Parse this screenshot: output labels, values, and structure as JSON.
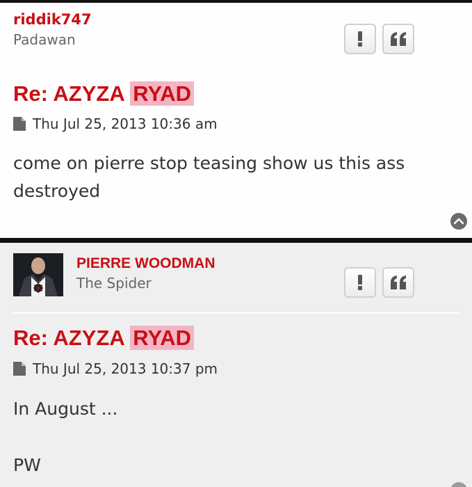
{
  "posts": [
    {
      "username": "riddik747",
      "rank": "Padawan",
      "title_prefix": "Re: AZYZA",
      "title_highlight": "RYAD",
      "date": "Thu Jul 25, 2013 10:36 am",
      "content_lines": [
        "come on pierre stop teasing show us this ass",
        "destroyed"
      ]
    },
    {
      "username": "PIERRE WOODMAN",
      "rank": "The Spider",
      "title_prefix": "Re: AZYZA",
      "title_highlight": "RYAD",
      "date": "Thu Jul 25, 2013 10:37 pm",
      "content_lines": [
        "In August ...",
        "",
        "PW"
      ]
    }
  ],
  "icons": {
    "report": "exclamation-icon",
    "quote": "quote-icon",
    "post": "file-icon",
    "back_to_top": "chevron-up-icon"
  },
  "colors": {
    "username": "#c90f13",
    "title": "#c90f13",
    "highlight": "#f3b5c6",
    "post_bg_1": "#fefefe",
    "post_bg_2": "#efefef",
    "separator": "#111111"
  }
}
